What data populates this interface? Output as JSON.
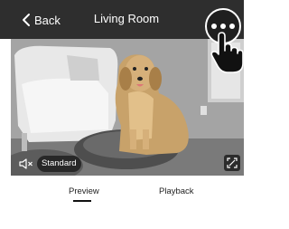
{
  "header": {
    "back_label": "Back",
    "title": "Living Room"
  },
  "player": {
    "quality_label": "Standard"
  },
  "tabs": [
    {
      "label": "Preview",
      "active": true
    },
    {
      "label": "Playback",
      "active": false
    }
  ],
  "icons": {
    "back": "chevron-left-icon",
    "more": "more-options-icon",
    "cursor": "hand-pointer-icon",
    "audio": "speaker-muted-icon",
    "fullscreen": "fullscreen-icon"
  },
  "colors": {
    "topbar": "#2e2e2e",
    "more_button": "#1f1f1f"
  }
}
